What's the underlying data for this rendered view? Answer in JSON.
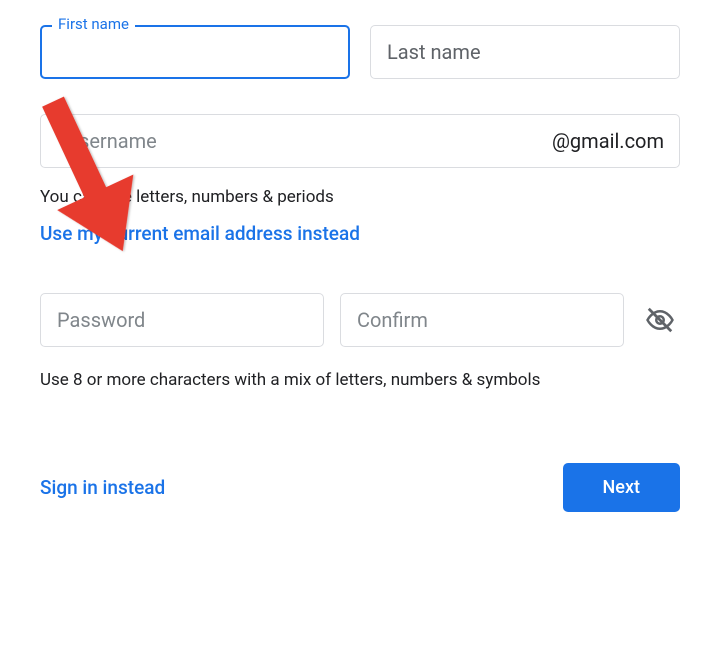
{
  "form": {
    "firstName": {
      "label": "First name",
      "value": ""
    },
    "lastName": {
      "placeholder": "Last name",
      "value": ""
    },
    "username": {
      "placeholder": "sername",
      "value": "",
      "suffix": "@gmail.com"
    },
    "usernameHelper": "You can use letters, numbers & periods",
    "useCurrentEmail": "Use my current email address instead",
    "password": {
      "placeholder": "Password",
      "value": ""
    },
    "confirm": {
      "placeholder": "Confirm",
      "value": ""
    },
    "passwordHelper": "Use 8 or more characters with a mix of letters, numbers & symbols"
  },
  "actions": {
    "signInInstead": "Sign in instead",
    "next": "Next"
  },
  "colors": {
    "primary": "#1a73e8",
    "border": "#dadce0",
    "text": "#202124",
    "placeholder": "#5f6368",
    "annotation": "#e73a2e"
  }
}
